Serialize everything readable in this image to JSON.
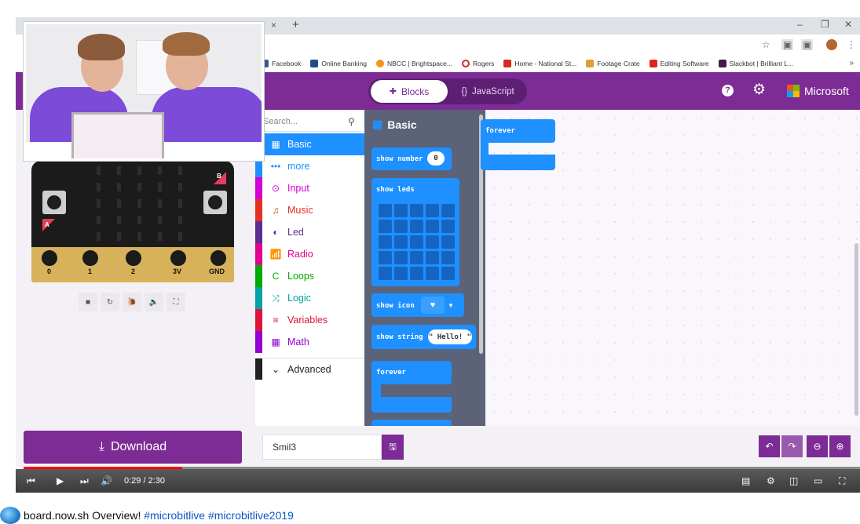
{
  "browser": {
    "close_tab": "×",
    "new_tab": "+",
    "minimize": "–",
    "restore": "❐",
    "close": "✕",
    "bookmarks": [
      "Facebook",
      "Online Banking",
      "NBCC | Brightspace...",
      "Rogers",
      "Home - National St...",
      "Footage Crate",
      "Editing Software",
      "Slackbot | Brilliant L..."
    ],
    "bookmarks_more": "»"
  },
  "header": {
    "blocks_label": "Blocks",
    "js_label": "JavaScript",
    "brand": "Microsoft",
    "help": "?"
  },
  "simulator": {
    "pins": [
      "0",
      "1",
      "2",
      "3V",
      "GND"
    ],
    "button_a": "A",
    "button_b": "B"
  },
  "toolbox": {
    "search_placeholder": "Search...",
    "categories": [
      {
        "label": "Basic",
        "color": "#1e90ff",
        "icon": "▦"
      },
      {
        "label": "more",
        "color": "#1e90ff",
        "icon": "•••"
      },
      {
        "label": "Input",
        "color": "#d400d4",
        "icon": "⊙"
      },
      {
        "label": "Music",
        "color": "#e63022",
        "icon": "♫"
      },
      {
        "label": "Led",
        "color": "#5c2d91",
        "icon": "◐"
      },
      {
        "label": "Radio",
        "color": "#e3008c",
        "icon": "📶"
      },
      {
        "label": "Loops",
        "color": "#00aa00",
        "icon": "C"
      },
      {
        "label": "Logic",
        "color": "#00a4a6",
        "icon": "⤨"
      },
      {
        "label": "Variables",
        "color": "#dc143c",
        "icon": "≡"
      },
      {
        "label": "Math",
        "color": "#9400d3",
        "icon": "▦"
      },
      {
        "label": "Advanced",
        "color": "#222222",
        "icon": "⌄"
      }
    ]
  },
  "flyout": {
    "title": "Basic",
    "show_number": "show number",
    "number_value": "0",
    "show_leds": "show leds",
    "show_icon": "show icon",
    "show_string": "show string",
    "string_value": "\" Hello! \"",
    "forever": "forever"
  },
  "workspace": {
    "forever_block": "forever"
  },
  "bottom": {
    "download_label": "Download",
    "project_name": "Smil3"
  },
  "player": {
    "time": "0:29 / 2:30",
    "progress": 0.19
  },
  "video": {
    "title_prefix": "board.now.sh Overview!",
    "hashtag1": "#microbitlive",
    "hashtag2": "#microbitlive2019"
  }
}
